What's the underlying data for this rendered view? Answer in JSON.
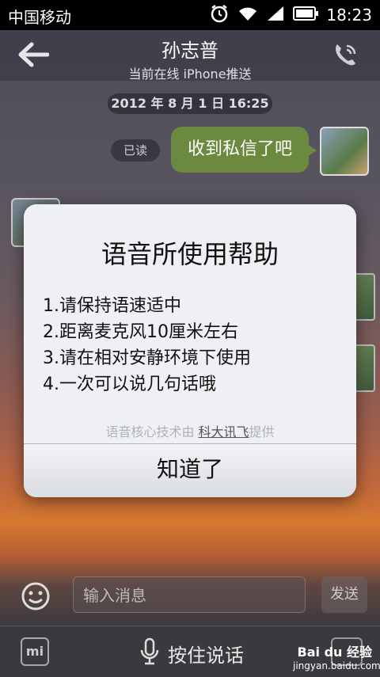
{
  "status_bar": {
    "carrier": "中国移动",
    "time": "18:23"
  },
  "header": {
    "name": "孙志普",
    "status": "当前在线 iPhone推送"
  },
  "chat": {
    "timestamp": "2012 年 8 月 1 日 16:25",
    "read_badge": "已读",
    "outgoing_message": "收到私信了吧"
  },
  "dialog": {
    "title": "语音所使用帮助",
    "items": [
      "1.请保持语速适中",
      "2.距离麦克风10厘米左右",
      "3.请在相对安静环境下使用",
      "4.一次可以说几句话哦"
    ],
    "credit_prefix": "语音核心技术由 ",
    "credit_link": "科大讯飞",
    "credit_suffix": "提供",
    "ok_button": "知道了"
  },
  "composer": {
    "placeholder": "输入消息",
    "send_label": "发送"
  },
  "bottom_bar": {
    "mi_label": "mi",
    "voice_label": "按住说话"
  },
  "watermark": {
    "brand": "Bai du 经验",
    "url": "jingyan.baidu.com"
  }
}
